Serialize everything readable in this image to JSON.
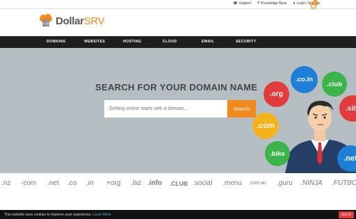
{
  "topbar": {
    "support": "Support",
    "knowledge_base": "Knowledge Base",
    "login": "Login / Sign up",
    "cart_count": "0"
  },
  "logo": {
    "dollar": "Dollar",
    "srv": "SRV"
  },
  "nav": [
    "DOMAINS",
    "WEBSITES",
    "HOSTING",
    "CLOUD",
    "EMAIL",
    "SECURITY"
  ],
  "hero": {
    "title": "SEARCH FOR YOUR DOMAIN NAME",
    "placeholder": "Getting online starts with a domain...",
    "search_label": "Search"
  },
  "bubbles": [
    {
      "label": ".co.in",
      "color": "#1f7fd6"
    },
    {
      "label": ".org",
      "color": "#e23b3b"
    },
    {
      "label": ".club",
      "color": "#3bb44a"
    },
    {
      "label": ".site",
      "color": "#e23b3b"
    },
    {
      "label": ".com",
      "color": "#f6b21a"
    },
    {
      "label": ".bike",
      "color": "#3bb44a"
    },
    {
      "label": ".net",
      "color": "#1f7fd6"
    }
  ],
  "tlds": [
    ".nz",
    "-com",
    ".net",
    ".co",
    ".in",
    "+org",
    ".biz",
    ".info",
    ".CLUB",
    ".social",
    ".menu",
    ".com.au",
    ".guru",
    ".NINJA",
    ".FUTBOL"
  ],
  "cookie": {
    "text": "This website uses cookies to improve your experience.",
    "link": "Learn More",
    "button": "Got It"
  }
}
